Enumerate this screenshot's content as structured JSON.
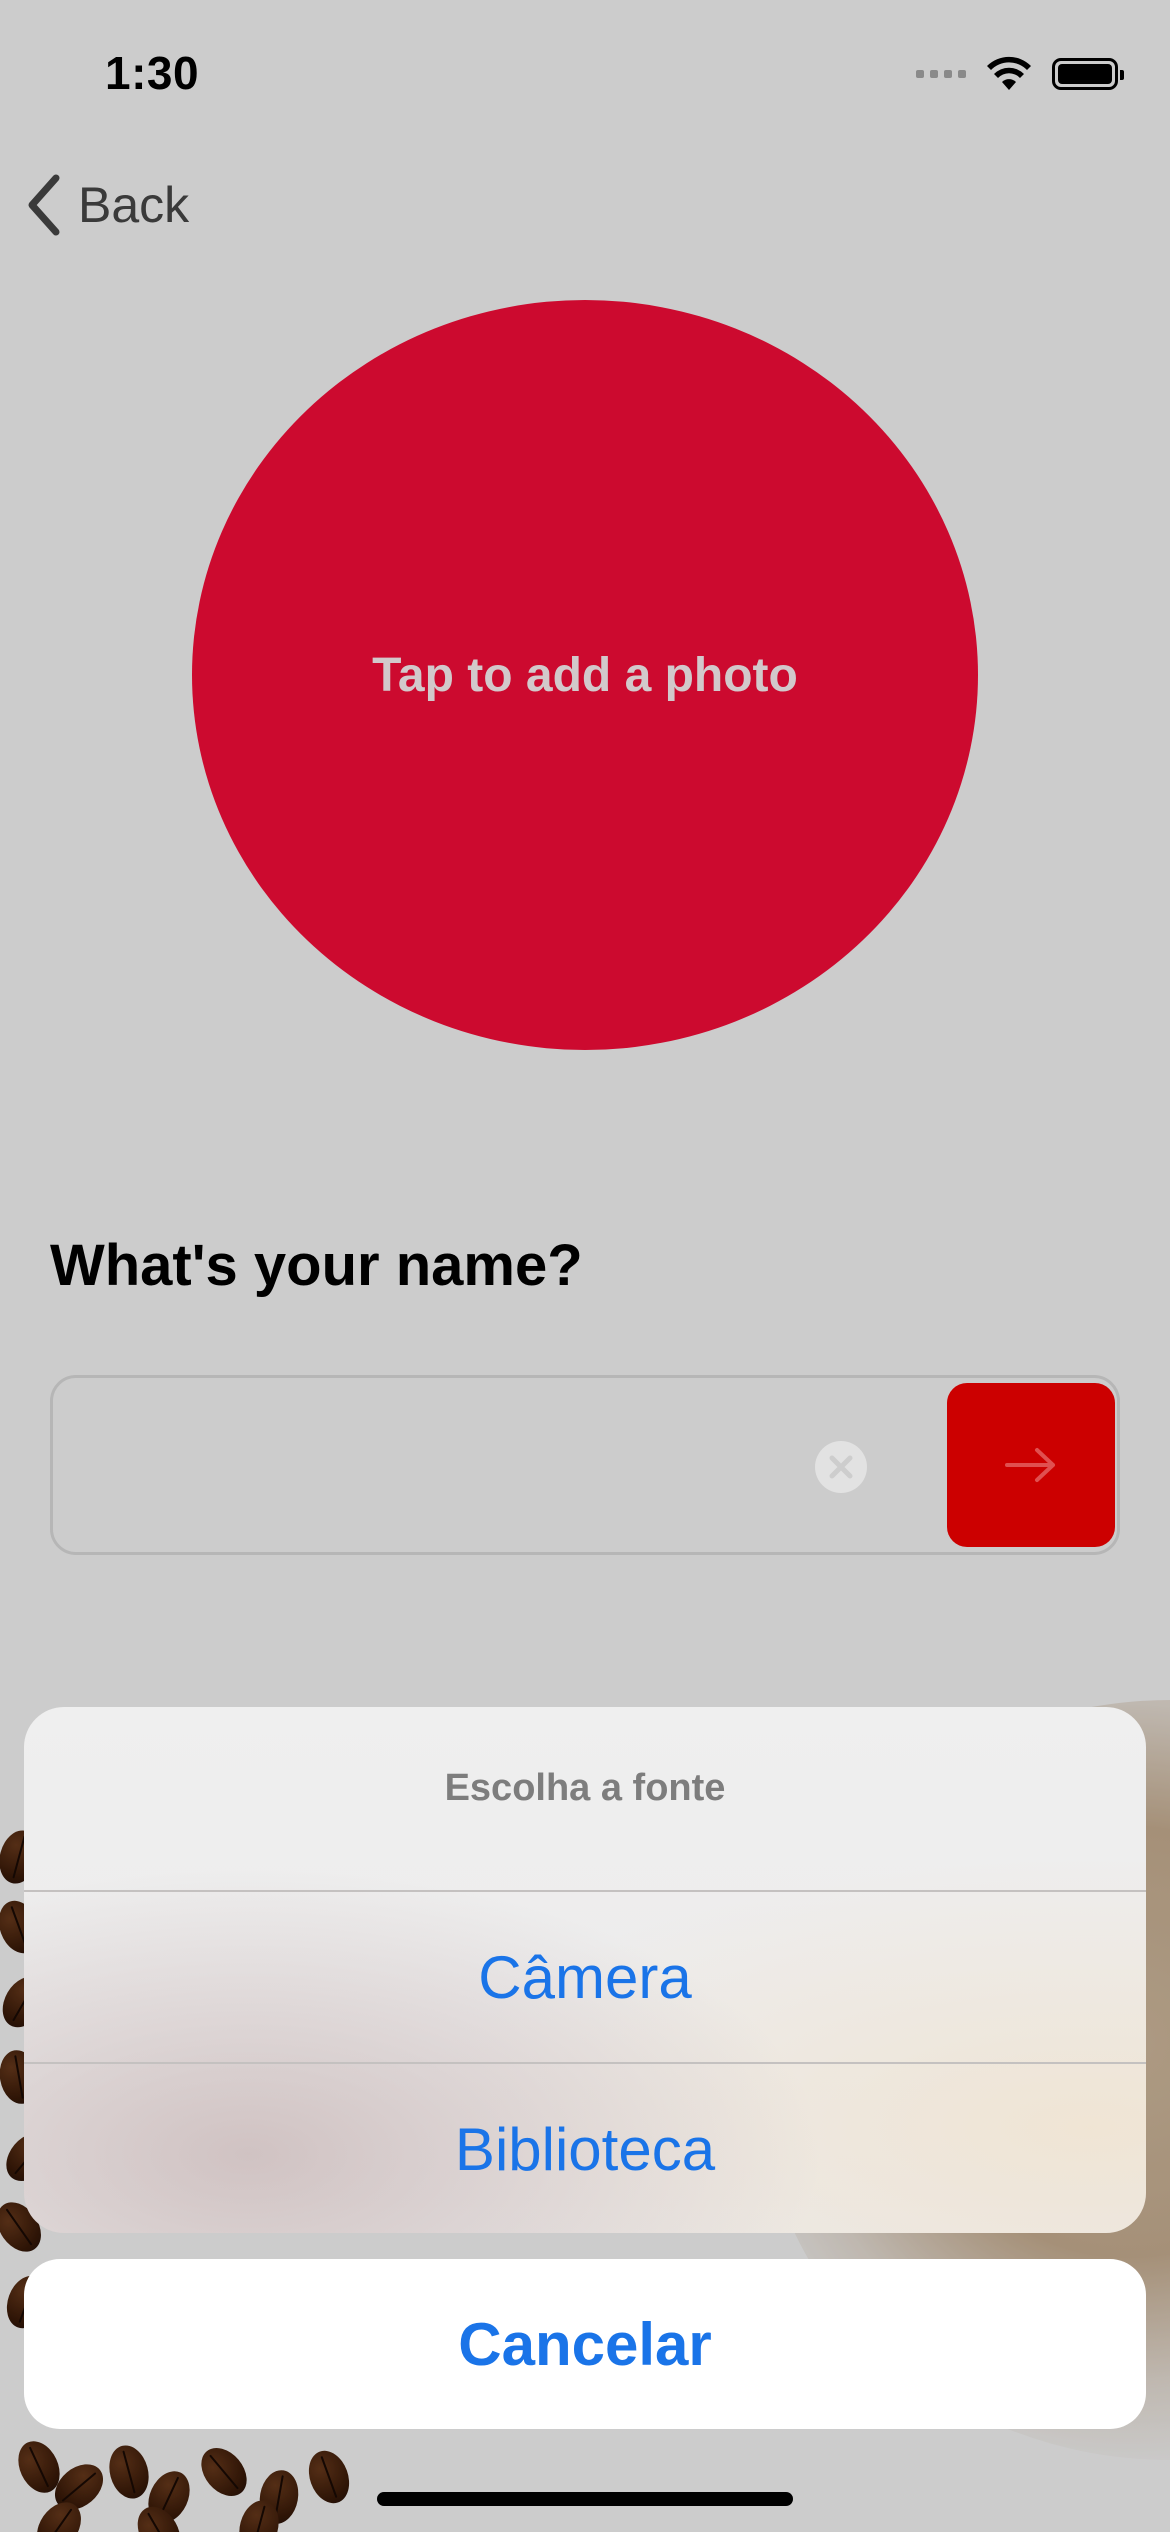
{
  "status_bar": {
    "time": "1:30",
    "wifi_icon": "wifi-icon",
    "battery_icon": "battery-icon"
  },
  "nav": {
    "back_label": "Back",
    "back_icon": "chevron-left-icon"
  },
  "photo": {
    "label": "Tap to add a photo",
    "color": "#cc0a2f"
  },
  "name": {
    "heading": "What's your name?",
    "input_value": "",
    "placeholder": "",
    "clear_icon": "clear-circle-icon",
    "submit_icon": "arrow-right-icon",
    "submit_color": "#cc0000"
  },
  "action_sheet": {
    "title": "Escolha a fonte",
    "options": [
      {
        "label": "Câmera"
      },
      {
        "label": "Biblioteca"
      }
    ],
    "cancel_label": "Cancelar",
    "accent": "#1a74e8"
  }
}
